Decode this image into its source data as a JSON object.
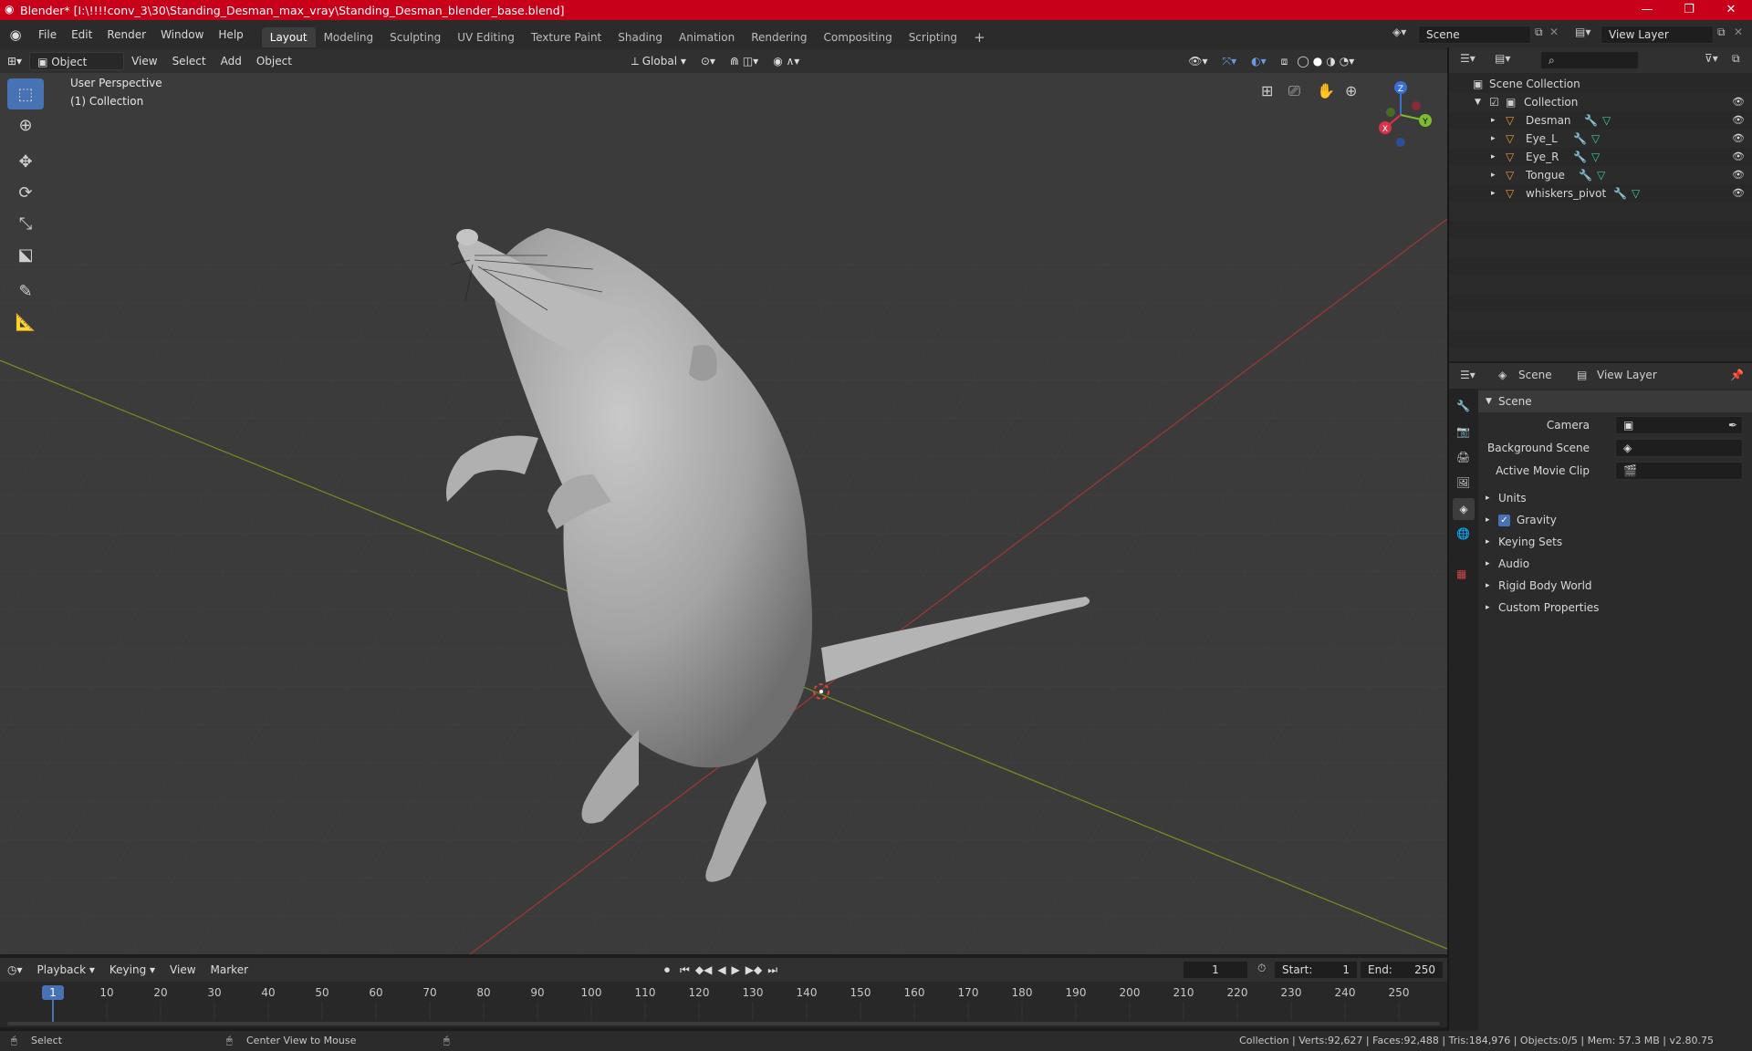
{
  "window": {
    "title": "Blender* [I:\\!!!!conv_3\\30\\Standing_Desman_max_vray\\Standing_Desman_blender_base.blend]",
    "controls": [
      "—",
      "❐",
      "✕"
    ]
  },
  "menu": [
    "File",
    "Edit",
    "Render",
    "Window",
    "Help"
  ],
  "workspaces": [
    "Layout",
    "Modeling",
    "Sculpting",
    "UV Editing",
    "Texture Paint",
    "Shading",
    "Animation",
    "Rendering",
    "Compositing",
    "Scripting"
  ],
  "scene_field": "Scene",
  "view_layer_field": "View Layer",
  "viewport_header": {
    "mode": "Object Mode",
    "menus": [
      "View",
      "Select",
      "Add",
      "Object"
    ],
    "orientation": "Global"
  },
  "viewport": {
    "perspective": "User Perspective",
    "collection": "(1) Collection",
    "gizmo_axes": {
      "z": "Z",
      "y": "Y",
      "x": "X"
    }
  },
  "outliner": {
    "root": "Scene Collection",
    "collection": "Collection",
    "objects": [
      "Desman",
      "Eye_L",
      "Eye_R",
      "Tongue",
      "whiskers_pivot"
    ]
  },
  "properties": {
    "tab_scene": "Scene",
    "tab_view_layer": "View Layer",
    "panel_title": "Scene",
    "camera_label": "Camera",
    "background_label": "Background Scene",
    "movie_clip_label": "Active Movie Clip",
    "sections": [
      "Units",
      "Gravity",
      "Keying Sets",
      "Audio",
      "Rigid Body World",
      "Custom Properties"
    ],
    "gravity_checked": true
  },
  "timeline": {
    "menus": [
      "Playback",
      "Keying",
      "View",
      "Marker"
    ],
    "current_frame": "1",
    "start_label": "Start:",
    "start_value": "1",
    "end_label": "End:",
    "end_value": "250",
    "ticks": [
      "1",
      "10",
      "20",
      "30",
      "40",
      "50",
      "60",
      "70",
      "80",
      "90",
      "100",
      "110",
      "120",
      "130",
      "140",
      "150",
      "160",
      "170",
      "180",
      "190",
      "200",
      "210",
      "220",
      "230",
      "240",
      "250"
    ]
  },
  "status": {
    "left": "Select",
    "middle": "Center View to Mouse",
    "right": "Collection | Verts:92,627 | Faces:92,488 | Tris:184,976 | Objects:0/5 | Mem: 57.3 MB | v2.80.75"
  }
}
